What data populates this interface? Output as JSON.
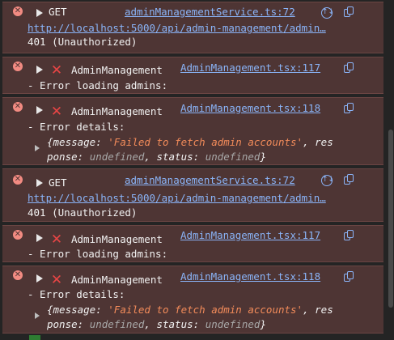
{
  "entries": [
    {
      "type": "network",
      "method": "GET",
      "source": "adminManagementService.ts:72",
      "url": "http://localhost:5000/api/admin-management/admin…",
      "status": "401 (Unauthorized)"
    },
    {
      "type": "error",
      "component": "AdminManagement",
      "source": "AdminManagement.tsx:117",
      "message": "- Error loading admins:"
    },
    {
      "type": "error-details",
      "component": "AdminManagement",
      "source": "AdminManagement.tsx:118",
      "message": "- Error details:",
      "object": {
        "open_brace": "{",
        "k_message": "message: ",
        "v_message": "'Failed to fetch admin accounts'",
        "sep1": ", res",
        "sep1b": "ponse: ",
        "v_response": "undefined",
        "sep2": ", ",
        "k_status": "status: ",
        "v_status": "undefined",
        "close_brace": "}"
      }
    },
    {
      "type": "network",
      "method": "GET",
      "source": "adminManagementService.ts:72",
      "url": "http://localhost:5000/api/admin-management/admin…",
      "status": "401 (Unauthorized)"
    },
    {
      "type": "error",
      "component": "AdminManagement",
      "source": "AdminManagement.tsx:117",
      "message": "- Error loading admins:"
    },
    {
      "type": "error-details",
      "component": "AdminManagement",
      "source": "AdminManagement.tsx:118",
      "message": "- Error details:",
      "object": {
        "open_brace": "{",
        "k_message": "message: ",
        "v_message": "'Failed to fetch admin accounts'",
        "sep1": ", res",
        "sep1b": "ponse: ",
        "v_response": "undefined",
        "sep2": ", ",
        "k_status": "status: ",
        "v_status": "undefined",
        "close_brace": "}"
      }
    }
  ],
  "icons": {
    "error": "error-circle-icon",
    "expand": "expand-triangle-icon",
    "cross": "cross-icon",
    "copy": "copy-icon",
    "network": "network-request-icon"
  },
  "colors": {
    "error_background": "#4e3534",
    "link": "#8ab4f8",
    "string": "#f28b5a",
    "undefined": "#a8a8a8",
    "cross": "#e94545"
  }
}
